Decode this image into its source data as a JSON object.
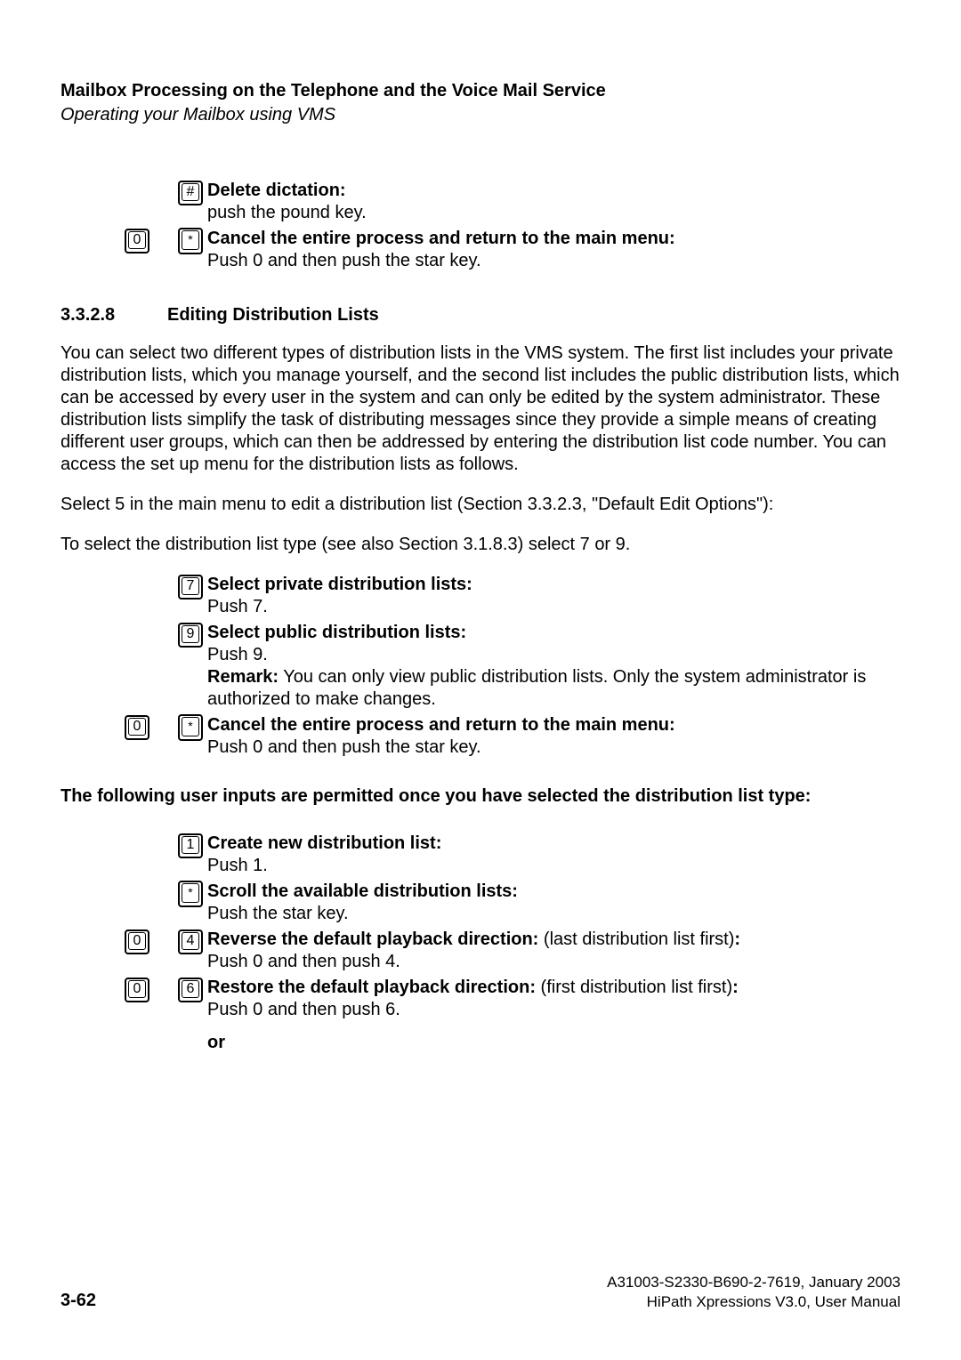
{
  "header": {
    "title": "Mailbox Processing on the Telephone and the Voice Mail Service",
    "subtitle": "Operating your Mailbox using VMS"
  },
  "blockA": {
    "item1": {
      "key": "#",
      "title": "Delete dictation:",
      "body": "push the pound key."
    },
    "item2": {
      "key1": "0",
      "key2": "*",
      "title": "Cancel the entire process and return to the main menu:",
      "body": "Push 0 and then push the star key."
    }
  },
  "section": {
    "num": "3.3.2.8",
    "title": "Editing Distribution Lists"
  },
  "para1": "You can select two different types of distribution lists in the VMS system. The first list includes your private distribution lists, which you manage yourself, and the second list includes the public distribution lists, which can be accessed by every user in the system and can only be edited by the system administrator. These distribution lists simplify the task of distributing messages since they provide a simple means of creating different user groups, which can then be addressed by entering the distribution list code number. You can access the set up menu for the distribution lists as follows.",
  "para2": "Select 5 in the main menu to edit a distribution list (Section 3.3.2.3, \"Default Edit Options\"):",
  "para3": "To select the distribution list type (see also Section 3.1.8.3) select 7 or 9.",
  "blockB": {
    "item1": {
      "key": "7",
      "title": "Select private distribution lists:",
      "body": "Push 7."
    },
    "item2": {
      "key": "9",
      "title": "Select public distribution lists:",
      "body": "Push 9.",
      "remark_label": "Remark:",
      "remark": " You can only view public distribution lists. Only the system administrator is authorized to make changes."
    },
    "item3": {
      "key1": "0",
      "key2": "*",
      "title": "Cancel the entire process and return to the main menu:",
      "body": "Push 0 and then push the star key."
    }
  },
  "subhead": "The following user inputs are permitted once you have selected the distribution list type:",
  "blockC": {
    "item1": {
      "key": "1",
      "title": "Create new distribution list:",
      "body": "Push 1."
    },
    "item2": {
      "key": "*",
      "title": "Scroll the available distribution lists:",
      "body": "Push the star key."
    },
    "item3": {
      "key1": "0",
      "key2": "4",
      "title": "Reverse the default playback direction: ",
      "note": "(last distribution list first)",
      "colon": ":",
      "body": "Push 0 and then push 4."
    },
    "item4": {
      "key1": "0",
      "key2": "6",
      "title": "Restore the default playback direction: ",
      "note": "(first distribution list first)",
      "colon": ":",
      "body": "Push 0 and then push 6."
    }
  },
  "or": "or",
  "footer": {
    "page": "3-62",
    "line1": "A31003-S2330-B690-2-7619, January 2003",
    "line2": "HiPath Xpressions V3.0, User Manual"
  }
}
